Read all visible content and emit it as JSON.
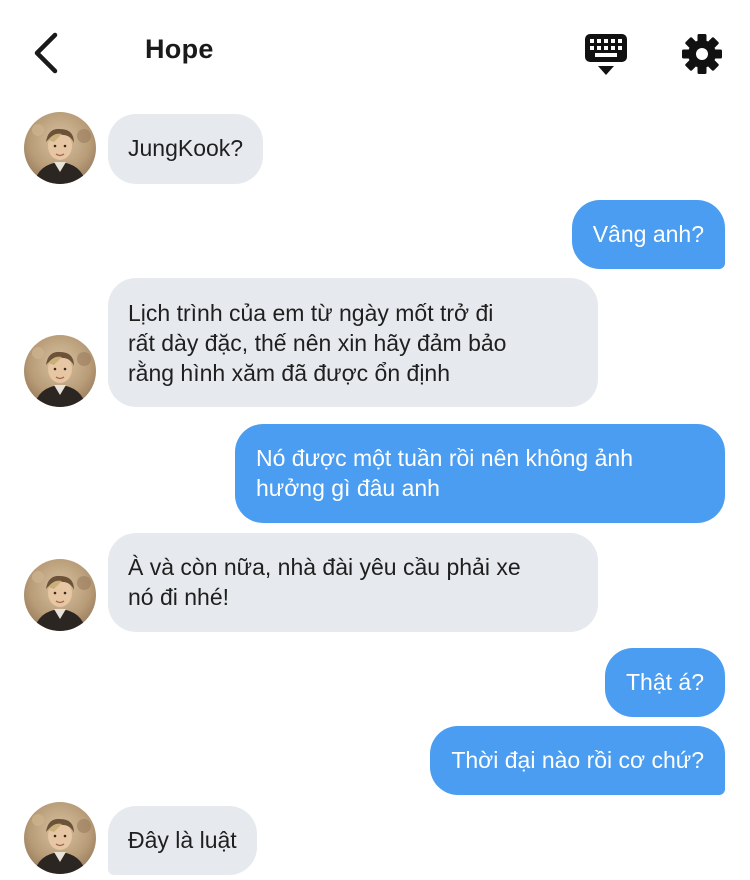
{
  "header": {
    "title": "Hope",
    "back_icon": "chevron-left-icon",
    "keyboard_icon": "keyboard-icon",
    "settings_icon": "gear-icon"
  },
  "colors": {
    "incoming_bubble": "#e6e9ed",
    "outgoing_bubble": "#4a9df0",
    "text_dark": "#1f1f1f",
    "text_light": "#ffffff"
  },
  "messages": [
    {
      "sender": "Hope",
      "direction": "incoming",
      "text": "JungKook?"
    },
    {
      "sender": "me",
      "direction": "outgoing",
      "text": "Vâng anh?"
    },
    {
      "sender": "Hope",
      "direction": "incoming",
      "text": "Lịch trình của em từ ngày mốt trở đi\nrất dày đặc, thế nên xin hãy đảm bảo\nrằng hình xăm đã được ổn định"
    },
    {
      "sender": "me",
      "direction": "outgoing",
      "text": "Nó được một tuần rồi nên không ảnh\nhưởng gì đâu anh"
    },
    {
      "sender": "Hope",
      "direction": "incoming",
      "text": "À và còn nữa, nhà đài yêu cầu phải xe\nnó đi nhé!"
    },
    {
      "sender": "me",
      "direction": "outgoing",
      "text": "Thật á?"
    },
    {
      "sender": "me",
      "direction": "outgoing",
      "text": "Thời đại nào rồi cơ chứ?"
    },
    {
      "sender": "Hope",
      "direction": "incoming",
      "text": "Đây là luật"
    }
  ]
}
